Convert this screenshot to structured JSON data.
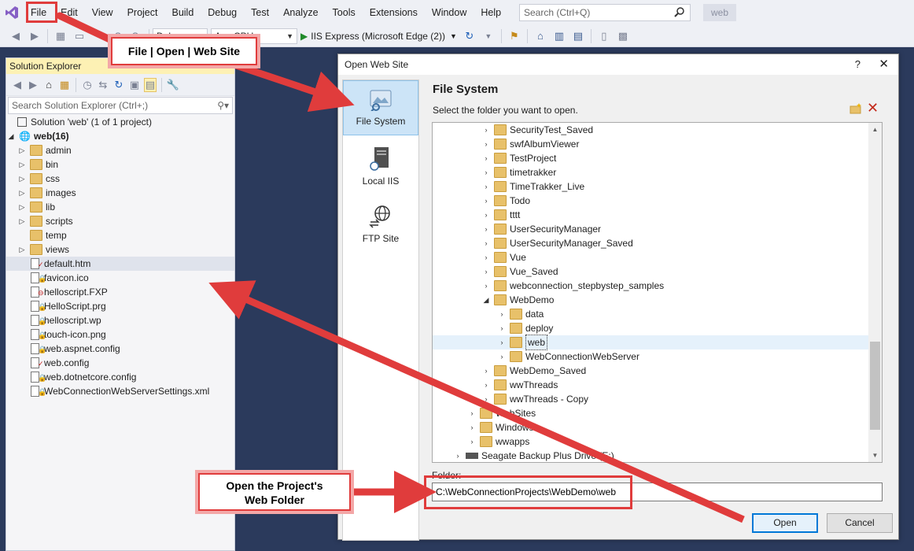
{
  "menubar": {
    "items": [
      "File",
      "Edit",
      "View",
      "Project",
      "Build",
      "Debug",
      "Test",
      "Analyze",
      "Tools",
      "Extensions",
      "Window",
      "Help"
    ],
    "search_placeholder": "Search (Ctrl+Q)",
    "project_badge": "web"
  },
  "toolbar": {
    "config_value": "Debug",
    "platform_value": "Any CPU",
    "run_label": "IIS Express (Microsoft Edge (2))"
  },
  "solution_explorer": {
    "title": "Solution Explorer",
    "search_placeholder": "Search Solution Explorer (Ctrl+;)",
    "solution_label": "Solution 'web' (1 of 1 project)",
    "project_label": "web(16)",
    "folders": [
      "admin",
      "bin",
      "css",
      "images",
      "lib",
      "scripts",
      "temp",
      "views"
    ],
    "files": [
      "default.htm",
      "favicon.ico",
      "helloscript.FXP",
      "HelloScript.prg",
      "helloscript.wp",
      "touch-icon.png",
      "web.aspnet.config",
      "web.config",
      "web.dotnetcore.config",
      "WebConnectionWebServerSettings.xml"
    ]
  },
  "dialog": {
    "title": "Open Web Site",
    "help_glyph": "?",
    "close_glyph": "✕",
    "locations": [
      {
        "label": "File System",
        "icon": "file-system-icon",
        "active": true
      },
      {
        "label": "Local IIS",
        "icon": "server-icon",
        "active": false
      },
      {
        "label": "FTP Site",
        "icon": "ftp-globe-icon",
        "active": false
      }
    ],
    "heading": "File System",
    "instruction": "Select the folder you want to open.",
    "tree": {
      "level1": [
        "SecurityTest_Saved",
        "swfAlbumViewer",
        "TestProject",
        "timetrakker",
        "TimeTrakker_Live",
        "Todo",
        "tttt",
        "UserSecurityManager",
        "UserSecurityManager_Saved",
        "Vue",
        "Vue_Saved",
        "webconnection_stepbystep_samples"
      ],
      "expanded": "WebDemo",
      "children": [
        "data",
        "deploy",
        "web",
        "WebConnectionWebServer"
      ],
      "level1_after": [
        "WebDemo_Saved",
        "wwThreads",
        "wwThreads - Copy"
      ],
      "level0": [
        "WebSites",
        "Windows",
        "wwapps"
      ],
      "drive": "Seagate Backup Plus Drive (E:)"
    },
    "folder_label": "Folder:",
    "folder_value": "C:\\WebConnectionProjects\\WebDemo\\web",
    "open_label": "Open",
    "cancel_label": "Cancel"
  },
  "callouts": {
    "menu_path": "File | Open | Web Site",
    "folder_line1": "Open the Project's",
    "folder_line2": "Web Folder"
  },
  "colors": {
    "accent_red": "#e03c3c",
    "se_title_bg": "#fdf1b4",
    "ide_bg": "#2b3a5c",
    "selection_blue": "#cce4f7"
  }
}
